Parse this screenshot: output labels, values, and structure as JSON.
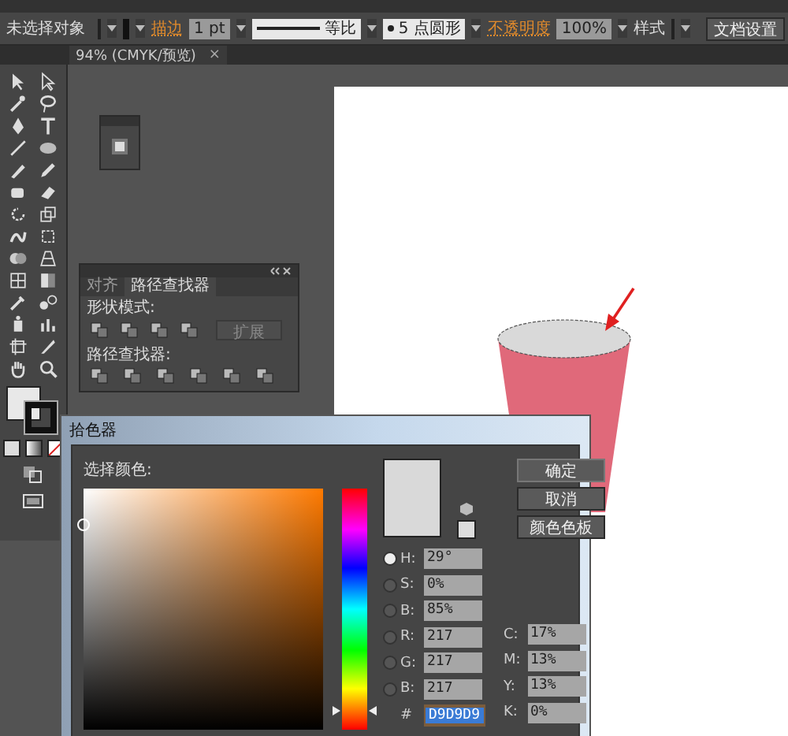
{
  "control_bar": {
    "selection": "未选择对象",
    "stroke_label": "描边",
    "stroke_weight": "1 pt",
    "stroke_profile": "等比",
    "brush": "5 点圆形",
    "opacity_label": "不透明度",
    "opacity": "100%",
    "style_label": "样式",
    "document_setup": "文档设置"
  },
  "document_tab": {
    "title": "94% (CMYK/预览)",
    "close": "×"
  },
  "pathfinder_panel": {
    "tabs": [
      {
        "label": "对齐",
        "selected": false
      },
      {
        "label": "路径查找器",
        "selected": true
      }
    ],
    "shape_modes_label": "形状模式:",
    "expand_button": {
      "label": "扩展",
      "disabled": true
    },
    "pathfinders_label": "路径查找器:"
  },
  "color_picker": {
    "title": "拾色器",
    "prompt": "选择颜色:",
    "field_marker": {
      "level": 0.85
    },
    "hue_slider": {
      "level": 0.08
    },
    "buttons": [
      "确定",
      "取消",
      "颜色色板"
    ],
    "fields": [
      {
        "label": "H:",
        "value": "29°",
        "selected": true
      },
      {
        "label": "S:",
        "value": "0%",
        "selected": false
      },
      {
        "label": "B:",
        "value": "85%",
        "selected": false
      },
      {
        "label": "R:",
        "value": "217",
        "selected": false
      },
      {
        "label": "G:",
        "value": "217",
        "selected": false
      },
      {
        "label": "B:",
        "value": "217",
        "selected": false
      }
    ],
    "hex": {
      "label": "#",
      "value": "D9D9D9"
    },
    "cmyk": [
      {
        "label": "C:",
        "value": "17%"
      },
      {
        "label": "M:",
        "value": "13%"
      },
      {
        "label": "Y:",
        "value": "13%"
      },
      {
        "label": "K:",
        "value": "0%"
      }
    ]
  }
}
